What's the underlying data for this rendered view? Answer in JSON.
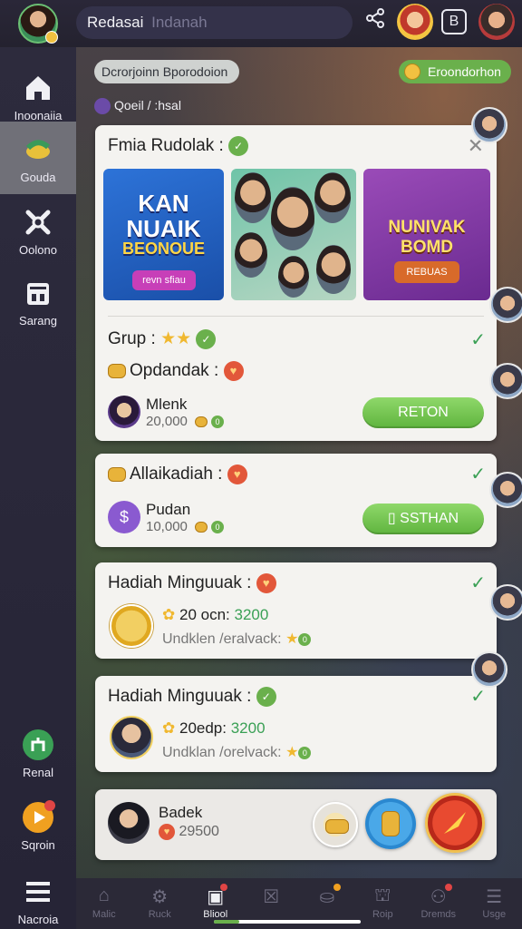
{
  "header": {
    "title": "Redasai",
    "title_sub": "Indanah"
  },
  "sidebar": {
    "items": [
      {
        "label": "Inoonaiia",
        "icon": "home-icon"
      },
      {
        "label": "Gouda",
        "icon": "gift-icon"
      },
      {
        "label": "Oolono",
        "icon": "wrench-icon"
      },
      {
        "label": "Sarang",
        "icon": "shop-icon"
      },
      {
        "label": "Renal",
        "icon": "trophy-icon"
      },
      {
        "label": "Sqroin",
        "icon": "play-icon"
      },
      {
        "label": "Nacroia",
        "icon": "menu-icon"
      }
    ]
  },
  "top_pills": {
    "left": "Dcrorjoinn Bporodoion",
    "right": "Eroondorhon"
  },
  "breadcrumb": "Qoeil / :hsal",
  "card1": {
    "title": "Fmia Rudolak :",
    "banner1": {
      "title": "KAN NUAIK",
      "sub": "BEONOUE",
      "button": "revn sfiau"
    },
    "banner3": {
      "title": "NUNIVAK BOMD",
      "button": "REBUAS"
    },
    "section_title": "Grup :",
    "sub_title": "Opdandak :",
    "user_name": "Mlenk",
    "user_value": "20,000",
    "button": "RETON"
  },
  "card2": {
    "title": "Allaikadiah :",
    "user_name": "Pudan",
    "user_value": "10,000",
    "button": "SSTHAN"
  },
  "card3": {
    "title": "Hadiah Minguuak :",
    "line1_label": "20 ocn:",
    "line1_value": "3200",
    "line2": "Undklen /eralvack:"
  },
  "card4": {
    "title": "Hadiah Minguuak :",
    "line1_label": "20edp:",
    "line1_value": "3200",
    "line2": "Undklan /orelvack:"
  },
  "footer_card": {
    "name": "Badek",
    "value": "29500"
  },
  "bottom_bar": {
    "items": [
      {
        "label": "Malic",
        "icon": "home-icon"
      },
      {
        "label": "Ruck",
        "icon": "gear-icon"
      },
      {
        "label": "Bliool",
        "icon": "box-icon"
      },
      {
        "label": "",
        "icon": "crossed-square-icon"
      },
      {
        "label": "",
        "icon": "bag-icon"
      },
      {
        "label": "Roip",
        "icon": "shop-icon"
      },
      {
        "label": "Dremds",
        "icon": "people-icon"
      },
      {
        "label": "Usge",
        "icon": "menu-icon"
      }
    ]
  },
  "colors": {
    "accent_green": "#6ab04c",
    "card_bg": "#f4f3f0",
    "sidebar_bg": "#2d2b3d"
  }
}
